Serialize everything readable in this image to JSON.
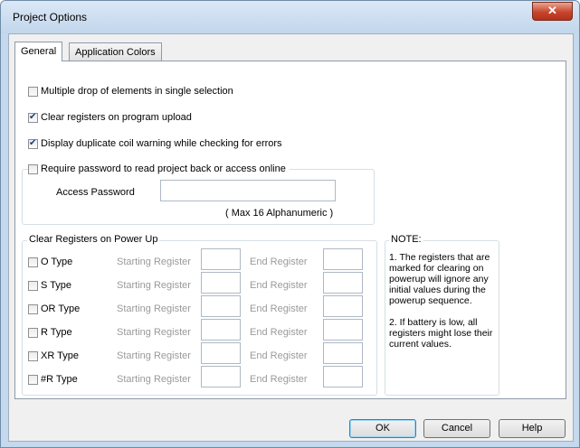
{
  "window": {
    "title": "Project Options",
    "close_glyph": "✕"
  },
  "tabs": [
    {
      "label": "General",
      "active": true
    },
    {
      "label": "Application Colors",
      "active": false
    }
  ],
  "options": {
    "multiple_drop": {
      "label": "Multiple drop of elements in single selection",
      "checked": false
    },
    "clear_registers": {
      "label": "Clear registers on program upload",
      "checked": true
    },
    "duplicate_coil": {
      "label": "Display duplicate coil warning while checking for errors",
      "checked": true
    },
    "require_password": {
      "label": "Require password to read project back or access online",
      "checked": false
    }
  },
  "password": {
    "label": "Access Password",
    "value": "",
    "hint": "( Max 16 Alphanumeric )"
  },
  "clear_power_up": {
    "legend": "Clear Registers on Power Up",
    "start_label": "Starting Register",
    "end_label": "End Register",
    "rows": [
      {
        "type": "O Type",
        "checked": false,
        "start": "",
        "end": ""
      },
      {
        "type": "S Type",
        "checked": false,
        "start": "",
        "end": ""
      },
      {
        "type": "OR Type",
        "checked": false,
        "start": "",
        "end": ""
      },
      {
        "type": "R Type",
        "checked": false,
        "start": "",
        "end": ""
      },
      {
        "type": "XR Type",
        "checked": false,
        "start": "",
        "end": ""
      },
      {
        "type": "#R Type",
        "checked": false,
        "start": "",
        "end": ""
      }
    ]
  },
  "note": {
    "legend": "NOTE:",
    "line1": "1. The registers that are marked for clearing on powerup will ignore any initial values during the powerup sequence.",
    "line2": "2. If battery is low, all registers might lose their current values."
  },
  "buttons": {
    "ok": "OK",
    "cancel": "Cancel",
    "help": "Help"
  },
  "colors": {
    "accent": "#3c7fb1",
    "close": "#c7452c",
    "frame": "#c4d8ee",
    "check": "#1c3d7a"
  }
}
